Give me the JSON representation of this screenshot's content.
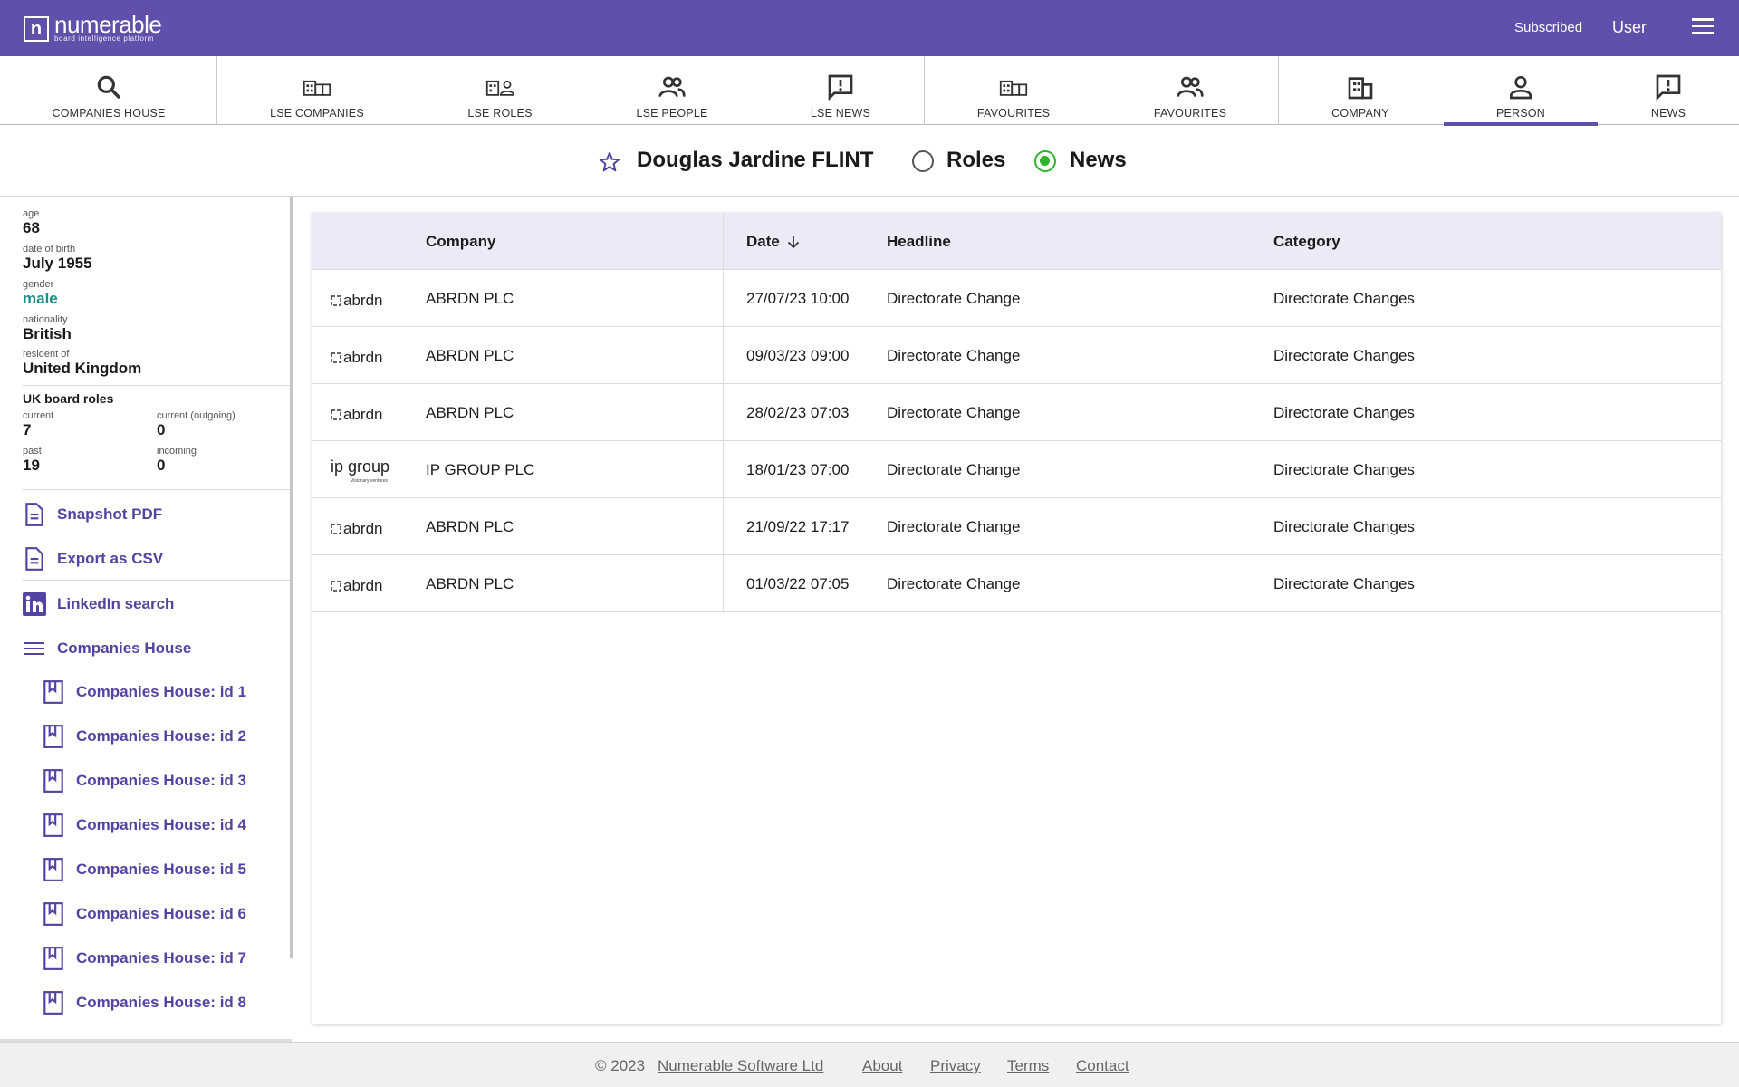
{
  "app": {
    "logo_mark": "n",
    "name": "numerable",
    "tagline": "board intelligence platform",
    "subscribed": "Subscribed",
    "user": "User"
  },
  "nav": {
    "tabs": [
      {
        "label": "COMPANIES HOUSE",
        "icon": "search-icon"
      },
      {
        "label": "LSE COMPANIES",
        "icon": "buildings-icon"
      },
      {
        "label": "LSE ROLES",
        "icon": "building-person-icon"
      },
      {
        "label": "LSE PEOPLE",
        "icon": "people-icon"
      },
      {
        "label": "LSE NEWS",
        "icon": "news-alert-icon"
      },
      {
        "label": "FAVOURITES",
        "icon": "buildings-icon"
      },
      {
        "label": "FAVOURITES",
        "icon": "people-icon"
      },
      {
        "label": "COMPANY",
        "icon": "building-icon"
      },
      {
        "label": "PERSON",
        "icon": "person-icon",
        "active": true
      },
      {
        "label": "NEWS",
        "icon": "news-alert-icon"
      }
    ]
  },
  "person": {
    "name": "Douglas Jardine FLINT",
    "views": [
      {
        "label": "Roles",
        "selected": false
      },
      {
        "label": "News",
        "selected": true
      }
    ]
  },
  "facts": [
    {
      "label": "age",
      "value": "68"
    },
    {
      "label": "date of birth",
      "value": "July 1955"
    },
    {
      "label": "gender",
      "value": "male"
    },
    {
      "label": "nationality",
      "value": "British"
    },
    {
      "label": "resident of",
      "value": "United Kingdom"
    }
  ],
  "board_roles": {
    "title": "UK board roles",
    "current_label": "current",
    "current": "7",
    "outgoing_label": "current (outgoing)",
    "outgoing": "0",
    "past_label": "past",
    "past": "19",
    "incoming_label": "incoming",
    "incoming": "0"
  },
  "links": {
    "snapshot": "Snapshot PDF",
    "export": "Export as CSV",
    "linkedin": "LinkedIn search",
    "companies_house": "Companies House",
    "ch_items": [
      "Companies House: id 1",
      "Companies House: id 2",
      "Companies House: id 3",
      "Companies House: id 4",
      "Companies House: id 5",
      "Companies House: id 6",
      "Companies House: id 7",
      "Companies House: id 8"
    ]
  },
  "table": {
    "headers": {
      "company": "Company",
      "date": "Date",
      "headline": "Headline",
      "category": "Category"
    },
    "rows": [
      {
        "logo": "abrdn",
        "company": "ABRDN PLC",
        "date": "27/07/23 10:00",
        "headline": "Directorate Change",
        "category": "Directorate Changes"
      },
      {
        "logo": "abrdn",
        "company": "ABRDN PLC",
        "date": "09/03/23 09:00",
        "headline": "Directorate Change",
        "category": "Directorate Changes"
      },
      {
        "logo": "abrdn",
        "company": "ABRDN PLC",
        "date": "28/02/23 07:03",
        "headline": "Directorate Change",
        "category": "Directorate Changes"
      },
      {
        "logo": "ip group",
        "logo_sub": "Visionary ventures",
        "company": "IP GROUP PLC",
        "date": "18/01/23 07:00",
        "headline": "Directorate Change",
        "category": "Directorate Changes"
      },
      {
        "logo": "abrdn",
        "company": "ABRDN PLC",
        "date": "21/09/22 17:17",
        "headline": "Directorate Change",
        "category": "Directorate Changes"
      },
      {
        "logo": "abrdn",
        "company": "ABRDN PLC",
        "date": "01/03/22 07:05",
        "headline": "Directorate Change",
        "category": "Directorate Changes"
      }
    ]
  },
  "footer": {
    "copyright": "© 2023",
    "company": "Numerable Software Ltd",
    "about": "About",
    "privacy": "Privacy",
    "terms": "Terms",
    "contact": "Contact"
  },
  "colors": {
    "brand": "#6150ab",
    "link": "#5443a3",
    "teal": "#1f8f8a",
    "radio_on": "#2bb52b",
    "header_row": "#eceaf7"
  }
}
